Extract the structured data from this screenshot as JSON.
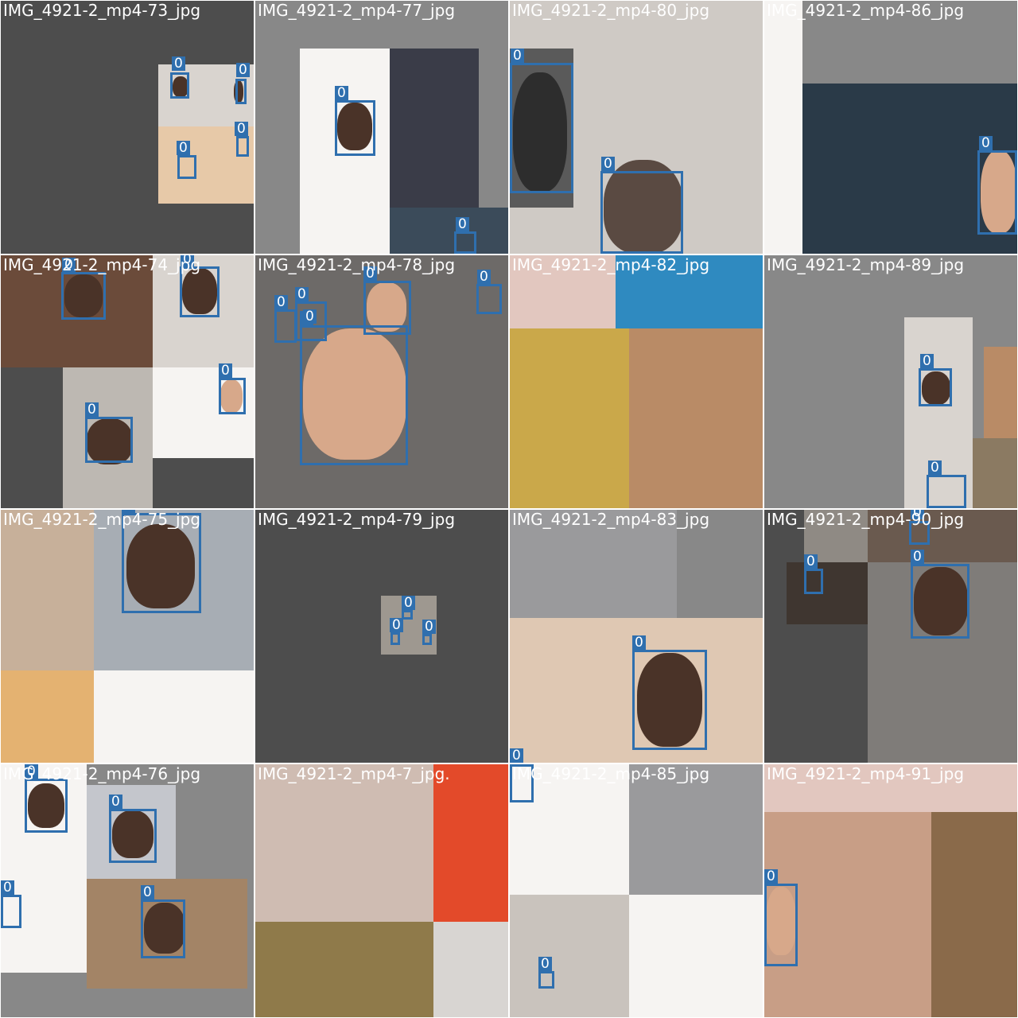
{
  "colors": {
    "bbox": "#2f6fae",
    "label_text": "#ffffff",
    "padding": "#4d4d4d",
    "grid_gap": "#ffffff"
  },
  "tiles": [
    {
      "title": "IMG_4921-2_mp4-73_jpg",
      "class_labels": [
        "0",
        "0",
        "0",
        "0"
      ]
    },
    {
      "title": "IMG_4921-2_mp4-77_jpg",
      "class_labels": [
        "0",
        "0"
      ]
    },
    {
      "title": "IMG_4921-2_mp4-80_jpg",
      "class_labels": [
        "0",
        "0"
      ]
    },
    {
      "title": "IMG_4921-2_mp4-86_jpg",
      "class_labels": [
        "0"
      ]
    },
    {
      "title": "IMG_4921-2_mp4-74_jpg",
      "class_labels": [
        "0",
        "0",
        "0",
        "0"
      ]
    },
    {
      "title": "IMG_4921-2_mp4-78_jpg",
      "class_labels": [
        "0",
        "0",
        "0",
        "0",
        "0",
        "0"
      ]
    },
    {
      "title": "IMG_4921-2_mp4-82_jpg",
      "class_labels": []
    },
    {
      "title": "IMG_4921-2_mp4-89_jpg",
      "class_labels": [
        "0",
        "0"
      ]
    },
    {
      "title": "IMG_4921-2_mp4-75_jpg",
      "class_labels": [
        "0"
      ]
    },
    {
      "title": "IMG_4921-2_mp4-79_jpg",
      "class_labels": [
        "0",
        "0",
        "0"
      ]
    },
    {
      "title": "IMG_4921-2_mp4-83_jpg",
      "class_labels": [
        "0",
        "0"
      ]
    },
    {
      "title": "IMG_4921-2_mp4-90_jpg",
      "class_labels": [
        "0",
        "0",
        "0",
        "0"
      ]
    },
    {
      "title": "IMG_4921-2_mp4-76_jpg",
      "class_labels": [
        "0",
        "0",
        "0",
        "0"
      ]
    },
    {
      "title": "IMG_4921-2_mp4-7_jpg.",
      "class_labels": []
    },
    {
      "title": "IMG_4921-2_mp4-85_jpg",
      "class_labels": [
        "0",
        "0"
      ]
    },
    {
      "title": "IMG_4921-2_mp4-91_jpg",
      "class_labels": [
        "0"
      ]
    }
  ]
}
